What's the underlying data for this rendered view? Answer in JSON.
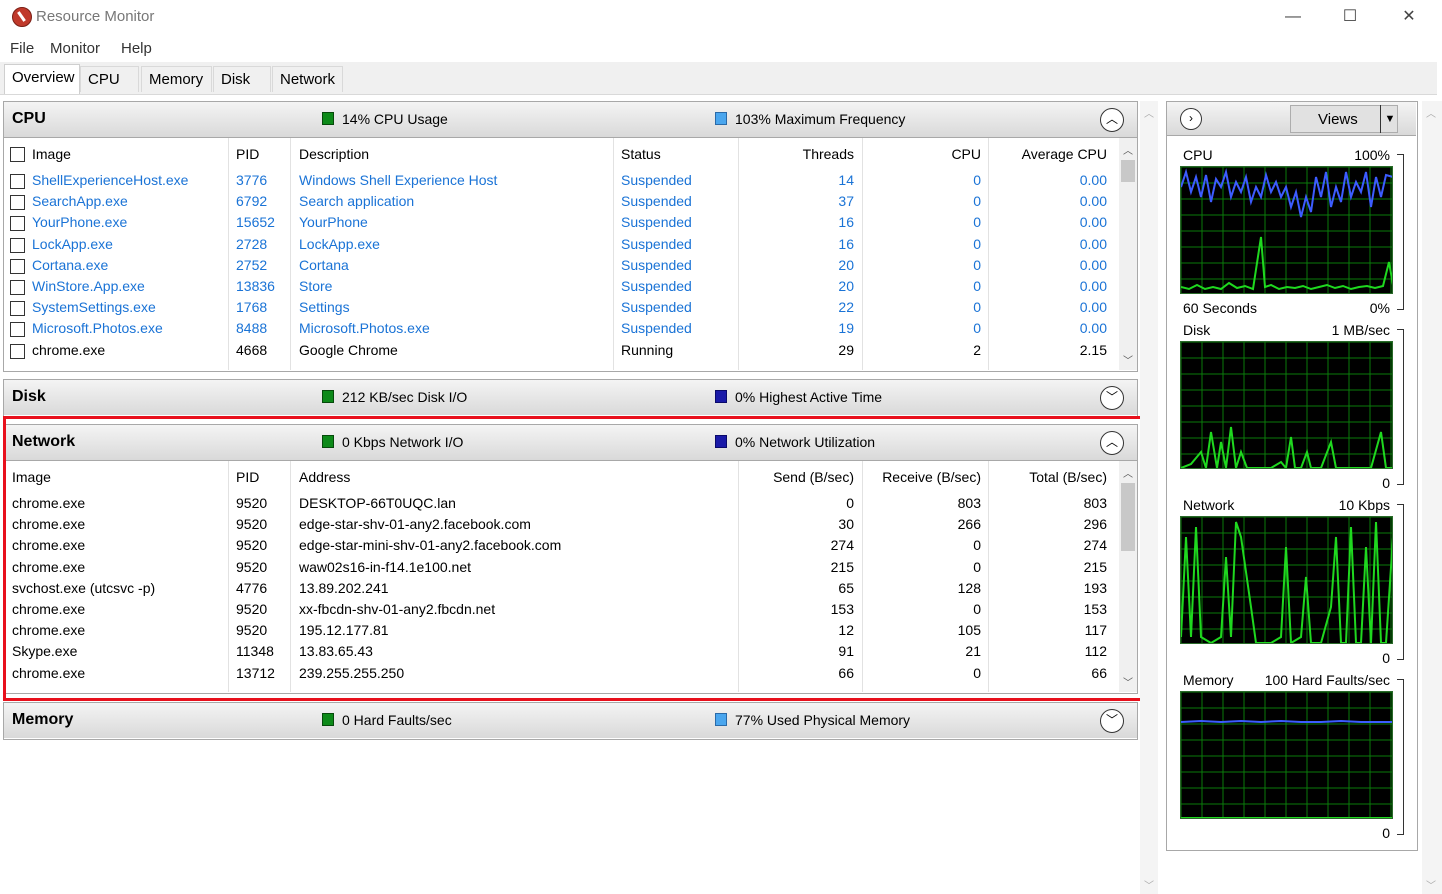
{
  "window": {
    "title": "Resource Monitor",
    "minimize": "—",
    "maximize": "☐",
    "close": "✕"
  },
  "menu": [
    "File",
    "Monitor",
    "Help"
  ],
  "tabs": [
    "Overview",
    "CPU",
    "Memory",
    "Disk",
    "Network"
  ],
  "cpu": {
    "title": "CPU",
    "usage": "14% CPU Usage",
    "frequency": "103% Maximum Frequency",
    "columns": [
      "Image",
      "PID",
      "Description",
      "Status",
      "Threads",
      "CPU",
      "Average CPU"
    ],
    "rows": [
      [
        "ShellExperienceHost.exe",
        "3776",
        "Windows Shell Experience Host",
        "Suspended",
        "14",
        "0",
        "0.00"
      ],
      [
        "SearchApp.exe",
        "6792",
        "Search application",
        "Suspended",
        "37",
        "0",
        "0.00"
      ],
      [
        "YourPhone.exe",
        "15652",
        "YourPhone",
        "Suspended",
        "16",
        "0",
        "0.00"
      ],
      [
        "LockApp.exe",
        "2728",
        "LockApp.exe",
        "Suspended",
        "16",
        "0",
        "0.00"
      ],
      [
        "Cortana.exe",
        "2752",
        "Cortana",
        "Suspended",
        "20",
        "0",
        "0.00"
      ],
      [
        "WinStore.App.exe",
        "13836",
        "Store",
        "Suspended",
        "20",
        "0",
        "0.00"
      ],
      [
        "SystemSettings.exe",
        "1768",
        "Settings",
        "Suspended",
        "22",
        "0",
        "0.00"
      ],
      [
        "Microsoft.Photos.exe",
        "8488",
        "Microsoft.Photos.exe",
        "Suspended",
        "19",
        "0",
        "0.00"
      ],
      [
        "chrome.exe",
        "4668",
        "Google Chrome",
        "Running",
        "29",
        "2",
        "2.15"
      ]
    ]
  },
  "disk": {
    "title": "Disk",
    "io": "212 KB/sec Disk I/O",
    "active": "0% Highest Active Time"
  },
  "network": {
    "title": "Network",
    "io": "0 Kbps Network I/O",
    "utilization": "0% Network Utilization",
    "columns": [
      "Image",
      "PID",
      "Address",
      "Send (B/sec)",
      "Receive (B/sec)",
      "Total (B/sec)"
    ],
    "rows": [
      [
        "chrome.exe",
        "9520",
        "DESKTOP-66T0UQC.lan",
        "0",
        "803",
        "803"
      ],
      [
        "chrome.exe",
        "9520",
        "edge-star-shv-01-any2.facebook.com",
        "30",
        "266",
        "296"
      ],
      [
        "chrome.exe",
        "9520",
        "edge-star-mini-shv-01-any2.facebook.com",
        "274",
        "0",
        "274"
      ],
      [
        "chrome.exe",
        "9520",
        "waw02s16-in-f14.1e100.net",
        "215",
        "0",
        "215"
      ],
      [
        "svchost.exe (utcsvc -p)",
        "4776",
        "13.89.202.241",
        "65",
        "128",
        "193"
      ],
      [
        "chrome.exe",
        "9520",
        "xx-fbcdn-shv-01-any2.fbcdn.net",
        "153",
        "0",
        "153"
      ],
      [
        "chrome.exe",
        "9520",
        "195.12.177.81",
        "12",
        "105",
        "117"
      ],
      [
        "Skype.exe",
        "11348",
        "13.83.65.43",
        "91",
        "21",
        "112"
      ],
      [
        "chrome.exe",
        "13712",
        "239.255.255.250",
        "66",
        "0",
        "66"
      ]
    ]
  },
  "memory": {
    "title": "Memory",
    "faults": "0 Hard Faults/sec",
    "used": "77% Used Physical Memory"
  },
  "right": {
    "views": "Views",
    "graphs": [
      {
        "name": "CPU",
        "max": "100%",
        "footer_left": "60 Seconds",
        "footer_right": "0%"
      },
      {
        "name": "Disk",
        "max": "1 MB/sec",
        "footer_left": "",
        "footer_right": "0"
      },
      {
        "name": "Network",
        "max": "10 Kbps",
        "footer_left": "",
        "footer_right": "0"
      },
      {
        "name": "Memory",
        "max": "100 Hard Faults/sec",
        "footer_left": "",
        "footer_right": "0"
      }
    ]
  },
  "colors": {
    "link": "#1a73d6",
    "highlight": "#e8101c",
    "graph_green": "#1fd81f",
    "graph_blue": "#3c5cff"
  }
}
